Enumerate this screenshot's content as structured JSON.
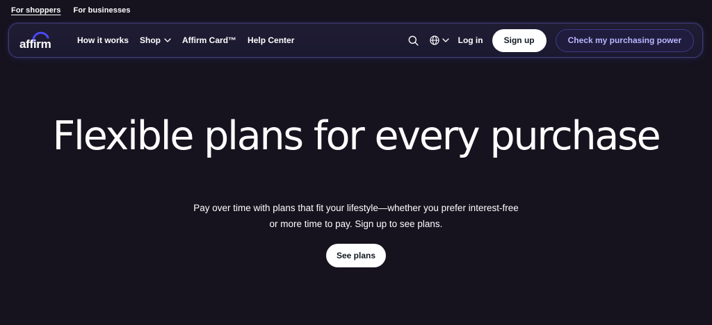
{
  "audience": {
    "shoppers_label": "For shoppers",
    "businesses_label": "For businesses"
  },
  "header": {
    "logo_text": "affirm",
    "nav": {
      "how_it_works": "How it works",
      "shop": "Shop",
      "affirm_card": "Affirm Card™",
      "help_center": "Help Center"
    },
    "login_label": "Log in",
    "signup_label": "Sign up",
    "check_power_label": "Check my purchasing power"
  },
  "hero": {
    "title": "Flexible plans for every purchase",
    "subtitle": "Pay over time with plans that fit your lifestyle—whether you prefer interest-free or more time to pay. Sign up to see plans.",
    "cta_label": "See plans"
  },
  "icons": {
    "search": "search-icon",
    "globe": "globe-icon",
    "chevron": "chevron-down-icon",
    "logo_arc": "affirm-arc-icon"
  },
  "colors": {
    "background": "#16131f",
    "accent": "#b9b6ff",
    "header_border": "#3b3870",
    "logo_arc": "#4a4af4"
  }
}
